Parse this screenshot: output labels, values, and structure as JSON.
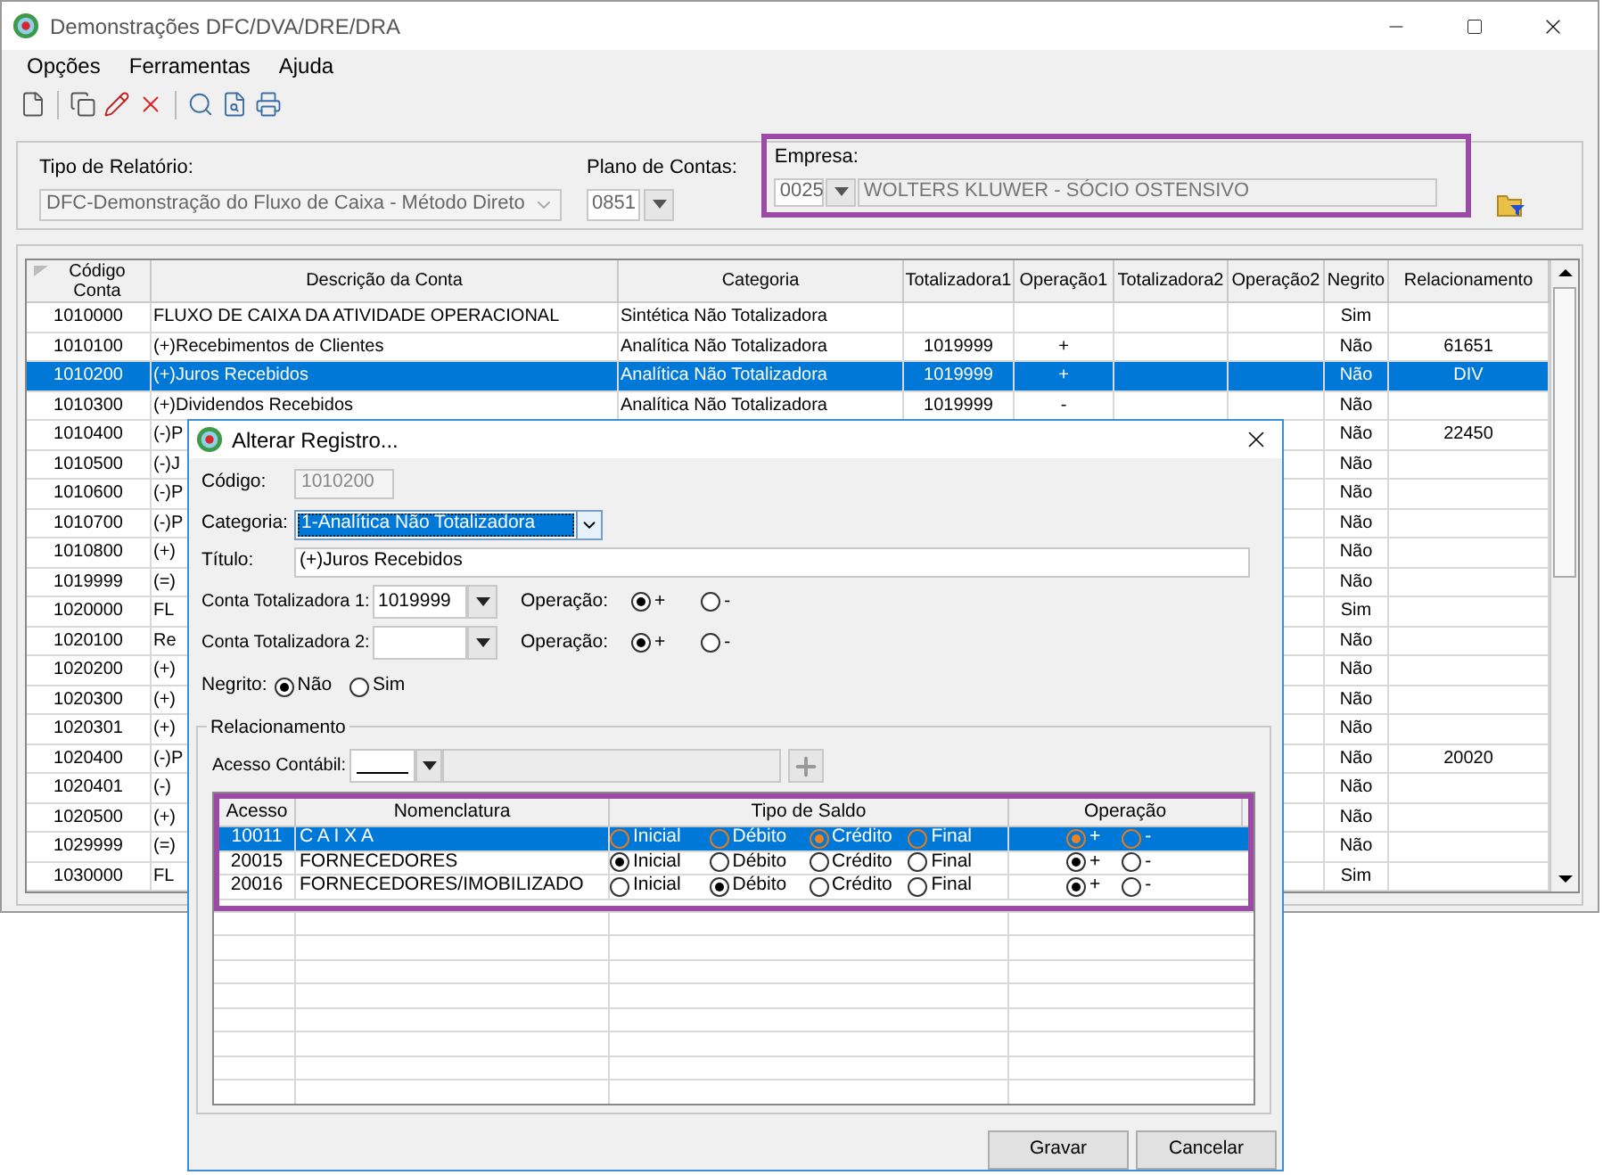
{
  "window": {
    "title": "Demonstrações DFC/DVA/DRE/DRA"
  },
  "menu": [
    "Opções",
    "Ferramentas",
    "Ajuda"
  ],
  "filters": {
    "tipo_label": "Tipo de Relatório:",
    "tipo_value": "DFC-Demonstração do Fluxo de Caixa - Método Direto",
    "plano_label": "Plano de Contas:",
    "plano_value": "0851",
    "empresa_label": "Empresa:",
    "empresa_code": "0025",
    "empresa_name": "WOLTERS KLUWER - SÓCIO OSTENSIVO"
  },
  "table": {
    "columns": [
      "Código Conta",
      "Descrição da Conta",
      "Categoria",
      "Totalizadora1",
      "Operação1",
      "Totalizadora2",
      "Operação2",
      "Negrito",
      "Relacionamento"
    ],
    "rows": [
      {
        "selected": false,
        "cells": [
          "1010000",
          "FLUXO DE CAIXA DA ATIVIDADE OPERACIONAL",
          "Sintética Não Totalizadora",
          "",
          "",
          "",
          "",
          "Sim",
          ""
        ]
      },
      {
        "selected": false,
        "cells": [
          "1010100",
          "(+)Recebimentos de Clientes",
          "Analítica Não Totalizadora",
          "1019999",
          "+",
          "",
          "",
          "Não",
          "61651"
        ]
      },
      {
        "selected": true,
        "cells": [
          "1010200",
          "(+)Juros Recebidos",
          "Analítica Não Totalizadora",
          "1019999",
          "+",
          "",
          "",
          "Não",
          "DIV"
        ]
      },
      {
        "selected": false,
        "cells": [
          "1010300",
          "(+)Dividendos Recebidos",
          "Analítica Não Totalizadora",
          "1019999",
          "-",
          "",
          "",
          "Não",
          ""
        ]
      },
      {
        "selected": false,
        "cells": [
          "1010400",
          "(-)P",
          "",
          "",
          "",
          "",
          "",
          "Não",
          "22450"
        ]
      },
      {
        "selected": false,
        "cells": [
          "1010500",
          "(-)J",
          "",
          "",
          "",
          "",
          "",
          "Não",
          ""
        ]
      },
      {
        "selected": false,
        "cells": [
          "1010600",
          "(-)P",
          "",
          "",
          "",
          "",
          "",
          "Não",
          ""
        ]
      },
      {
        "selected": false,
        "cells": [
          "1010700",
          "(-)P",
          "",
          "",
          "",
          "",
          "",
          "Não",
          ""
        ]
      },
      {
        "selected": false,
        "cells": [
          "1010800",
          "(+)",
          "",
          "",
          "",
          "",
          "",
          "Não",
          ""
        ]
      },
      {
        "selected": false,
        "cells": [
          "1019999",
          "(=)",
          "",
          "",
          "",
          "",
          "",
          "Não",
          ""
        ]
      },
      {
        "selected": false,
        "cells": [
          "1020000",
          "FL",
          "",
          "",
          "",
          "",
          "",
          "Sim",
          ""
        ]
      },
      {
        "selected": false,
        "cells": [
          "1020100",
          "Re",
          "",
          "",
          "",
          "",
          "",
          "Não",
          ""
        ]
      },
      {
        "selected": false,
        "cells": [
          "1020200",
          "(+)",
          "",
          "",
          "",
          "",
          "",
          "Não",
          ""
        ]
      },
      {
        "selected": false,
        "cells": [
          "1020300",
          "(+)",
          "",
          "",
          "",
          "",
          "",
          "Não",
          ""
        ]
      },
      {
        "selected": false,
        "cells": [
          "1020301",
          "(+)",
          "",
          "",
          "",
          "",
          "",
          "Não",
          ""
        ]
      },
      {
        "selected": false,
        "cells": [
          "1020400",
          "(-)P",
          "",
          "",
          "",
          "",
          "",
          "Não",
          "20020"
        ]
      },
      {
        "selected": false,
        "cells": [
          "1020401",
          "(-)",
          "",
          "",
          "",
          "",
          "",
          "Não",
          ""
        ]
      },
      {
        "selected": false,
        "cells": [
          "1020500",
          "(+)",
          "",
          "",
          "",
          "",
          "",
          "Não",
          ""
        ]
      },
      {
        "selected": false,
        "cells": [
          "1029999",
          "(=)",
          "",
          "",
          "",
          "",
          "",
          "Não",
          ""
        ]
      },
      {
        "selected": false,
        "cells": [
          "1030000",
          "FL",
          "",
          "",
          "",
          "",
          "",
          "Sim",
          ""
        ]
      }
    ]
  },
  "dialog": {
    "title": "Alterar Registro...",
    "codigo_label": "Código:",
    "codigo_value": "1010200",
    "categoria_label": "Categoria:",
    "categoria_value": "1-Analítica Não Totalizadora",
    "titulo_label": "Título:",
    "titulo_value": "(+)Juros Recebidos",
    "totalizadoras": [
      {
        "label": "Conta Totalizadora 1:",
        "value": "1019999",
        "op_label": "Operação:",
        "options": [
          {
            "label": "+",
            "selected": true
          },
          {
            "label": "-",
            "selected": false
          }
        ]
      },
      {
        "label": "Conta Totalizadora 2:",
        "op_label": "Operação:",
        "options": [
          {
            "label": "+",
            "selected": true
          },
          {
            "label": "-",
            "selected": false
          }
        ]
      }
    ],
    "negrito_label": "Negrito:",
    "negrito_options": [
      {
        "label": "Não",
        "selected": true
      },
      {
        "label": "Sim",
        "selected": false
      }
    ],
    "group_label": "Relacionamento",
    "acesso_label": "Acesso Contábil:",
    "grid": {
      "columns": [
        "Acesso",
        "Nomenclatura",
        "Tipo de Saldo",
        "Operação"
      ],
      "rows": [
        {
          "selected": true,
          "acesso": "10011",
          "nomenclatura": "C A I X A",
          "saldo": [
            {
              "label": "Inicial",
              "selected": false
            },
            {
              "label": "Débito",
              "selected": false
            },
            {
              "label": "Crédito",
              "selected": true
            },
            {
              "label": "Final",
              "selected": false
            }
          ],
          "operacao": [
            {
              "label": "+",
              "selected": true
            },
            {
              "label": "-",
              "selected": false
            }
          ]
        },
        {
          "selected": false,
          "acesso": "20015",
          "nomenclatura": "FORNECEDORES",
          "saldo": [
            {
              "label": "Inicial",
              "selected": true
            },
            {
              "label": "Débito",
              "selected": false
            },
            {
              "label": "Crédito",
              "selected": false
            },
            {
              "label": "Final",
              "selected": false
            }
          ],
          "operacao": [
            {
              "label": "+",
              "selected": true
            },
            {
              "label": "-",
              "selected": false
            }
          ]
        },
        {
          "selected": false,
          "acesso": "20016",
          "nomenclatura": "FORNECEDORES/IMOBILIZADO",
          "saldo": [
            {
              "label": "Inicial",
              "selected": false
            },
            {
              "label": "Débito",
              "selected": true
            },
            {
              "label": "Crédito",
              "selected": false
            },
            {
              "label": "Final",
              "selected": false
            }
          ],
          "operacao": [
            {
              "label": "+",
              "selected": true
            },
            {
              "label": "-",
              "selected": false
            }
          ]
        }
      ]
    },
    "buttons": [
      "Gravar",
      "Cancelar"
    ]
  }
}
